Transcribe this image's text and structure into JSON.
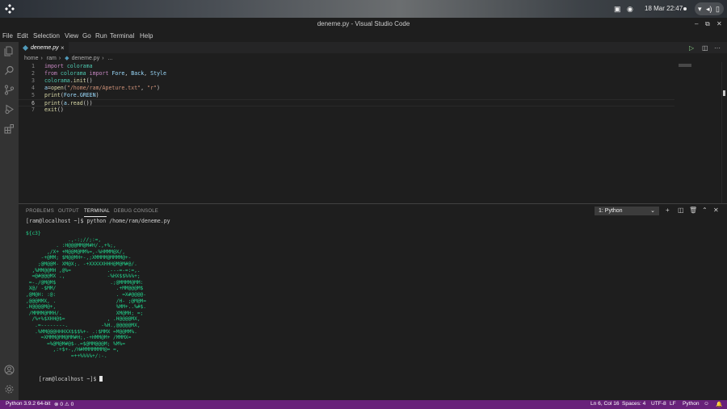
{
  "desktop": {
    "clock": "18 Mar  22:47",
    "tray_icons": [
      "wifi-icon",
      "volume-icon",
      "battery-icon"
    ],
    "app_icons": [
      "drive-icon",
      "discord-icon"
    ]
  },
  "window": {
    "title": "deneme.py - Visual Studio Code",
    "controls": [
      "minimize",
      "restore",
      "close"
    ]
  },
  "menu": [
    "File",
    "Edit",
    "Selection",
    "View",
    "Go",
    "Run",
    "Terminal",
    "Help"
  ],
  "activity_bar": [
    "explorer-icon",
    "search-icon",
    "source-control-icon",
    "run-debug-icon",
    "extensions-icon",
    "account-icon",
    "settings-gear-icon"
  ],
  "editor": {
    "tab_label": "deneme.py",
    "tab_close": "×",
    "breadcrumb": [
      "home",
      "ram",
      "deneme.py",
      "..."
    ],
    "lines": [
      {
        "n": "1",
        "text": "import colorama"
      },
      {
        "n": "2",
        "text": "from colorama import Fore, Back, Style"
      },
      {
        "n": "3",
        "text": "colorama.init()"
      },
      {
        "n": "4",
        "text": "a=open(\"/home/ram/Apeture.txt\", \"r\")"
      },
      {
        "n": "5",
        "text": "print(Fore.GREEN)"
      },
      {
        "n": "6",
        "text": "print(a.read())"
      },
      {
        "n": "7",
        "text": "exit()"
      }
    ]
  },
  "panel": {
    "tabs": [
      "PROBLEMS",
      "OUTPUT",
      "TERMINAL",
      "DEBUG CONSOLE"
    ],
    "active_tab": "TERMINAL",
    "terminal_select": "1: Python",
    "prompt_cmd": "[ram@localhost ~]$ python /home/ram/deneme.py",
    "ascii_art": "${c3}\n              .,-:;//;:=,\n          . :H@@@MM@M#H/.,+%;,\n       ,/X+ +M@@M@MM%=,-%HMMM@X/,\n     -+@MM; $M@@MH+-,;XMMMM@MMMM@+-\n    ;@M@@M- XM@X;. -+XXXXXHHH@M@M#@/.\n  ,%MM@@MH ,@%=            .---=-=:=,.\n  =@#@@@MX .,              -%HX$$%%%+;\n =-./@M@M$                  .;@MMMM@MM:\n X@/ -$MM/                    .+MM@@@M$\n,@M@H: :@:                    . =X#@@@@-\n,@@@MMX, .                    /H- ;@M@M=\n.H@@@@M@+,                    %MM+..%#$.\n /MMMM@MMH/.                  XM@MH; =;\n  /%+%$XHH@$=              , .H@@@@MX,\n   .=--------.           -%H.,@@@@@MX,\n   .%MM@@@HHHXX$$$%+- .:$MMX =M@@MM%.\n     =XMMM@MM@MM#H;,-+HMM@M+ /MMMX=\n       =%@M@M#@$-.=$@MM@@@M; %M%=\n         ,:+$+-,/H#MMMMMMM@= =,\n               =++%%%%+/:-.",
    "prompt_end": "[ram@localhost ~]$ "
  },
  "status_bar": {
    "interpreter": "Python 3.9.2 64-bit",
    "problems": "⊗ 0 ⚠ 0",
    "position": "Ln 6, Col 16",
    "spaces": "Spaces: 4",
    "encoding": "UTF-8",
    "eol": "LF",
    "language": "Python"
  }
}
